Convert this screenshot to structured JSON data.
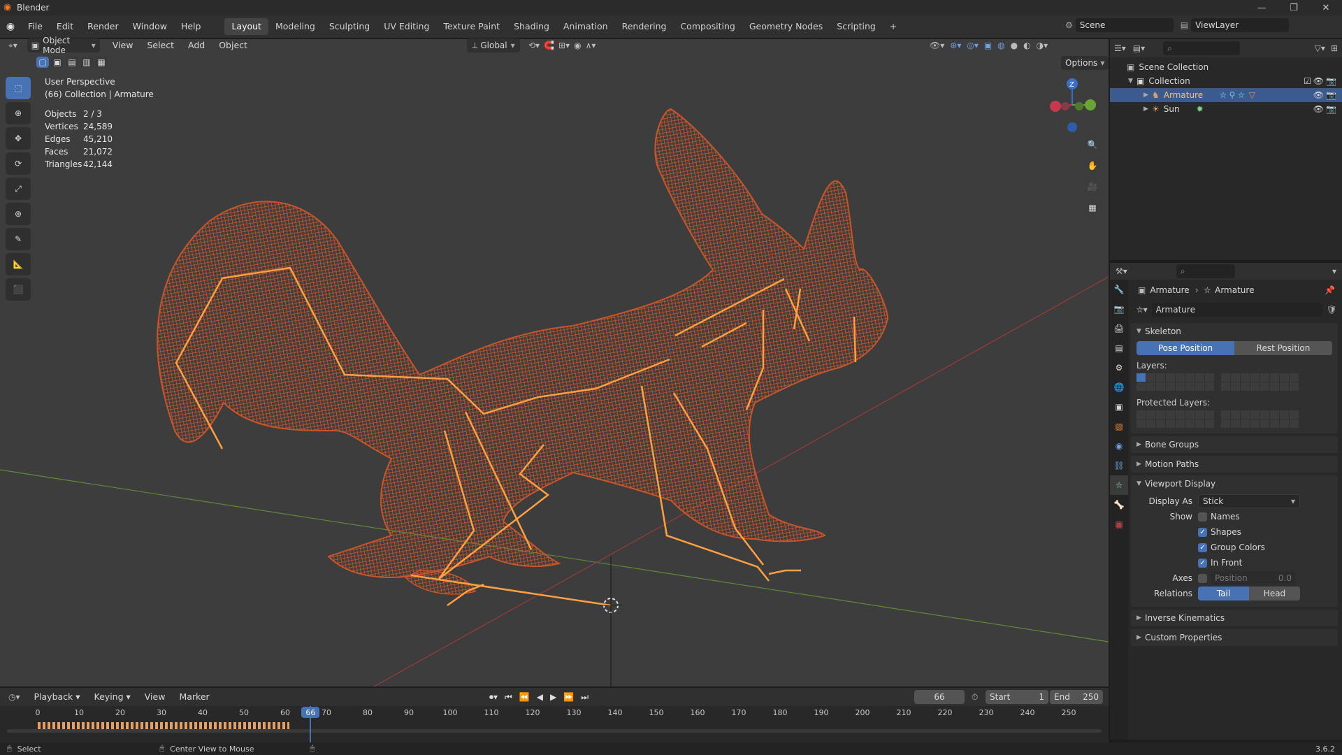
{
  "window": {
    "title": "Blender"
  },
  "menus": [
    "File",
    "Edit",
    "Render",
    "Window",
    "Help"
  ],
  "workspaces": [
    "Layout",
    "Modeling",
    "Sculpting",
    "UV Editing",
    "Texture Paint",
    "Shading",
    "Animation",
    "Rendering",
    "Compositing",
    "Geometry Nodes",
    "Scripting"
  ],
  "active_workspace": "Layout",
  "add_workspace": "+",
  "scene": {
    "name": "Scene",
    "view_layer": "ViewLayer"
  },
  "viewport": {
    "mode": "Object Mode",
    "menus": [
      "View",
      "Select",
      "Add",
      "Object"
    ],
    "transform_orientation": "Global",
    "options_label": "Options",
    "perspective": "User Perspective",
    "collection_line": "(66) Collection | Armature",
    "stats": [
      {
        "k": "Objects",
        "v": "2 / 3"
      },
      {
        "k": "Vertices",
        "v": "24,589"
      },
      {
        "k": "Edges",
        "v": "45,210"
      },
      {
        "k": "Faces",
        "v": "21,072"
      },
      {
        "k": "Triangles",
        "v": "42,144"
      }
    ],
    "gizmo": {
      "z": "Z"
    }
  },
  "outliner": {
    "scene_collection": "Scene Collection",
    "collection": "Collection",
    "items": [
      {
        "name": "Armature",
        "selected": true
      },
      {
        "name": "Sun",
        "selected": false
      }
    ]
  },
  "properties": {
    "breadcrumb_object": "Armature",
    "breadcrumb_data": "Armature",
    "data_name": "Armature",
    "skeleton": {
      "title": "Skeleton",
      "pose_position": "Pose Position",
      "rest_position": "Rest Position",
      "layers_label": "Layers:",
      "protected_layers_label": "Protected Layers:"
    },
    "bone_groups": "Bone Groups",
    "motion_paths": "Motion Paths",
    "viewport_display": {
      "title": "Viewport Display",
      "display_as_label": "Display As",
      "display_as_value": "Stick",
      "show_label": "Show",
      "names": "Names",
      "shapes": "Shapes",
      "group_colors": "Group Colors",
      "in_front": "In Front",
      "axes_label": "Axes",
      "position_label": "Position",
      "position_value": "0.0",
      "relations_label": "Relations",
      "tail": "Tail",
      "head": "Head"
    },
    "inverse_kinematics": "Inverse Kinematics",
    "custom_properties": "Custom Properties"
  },
  "timeline": {
    "menus": [
      "Playback",
      "Keying",
      "View",
      "Marker"
    ],
    "current_frame": "66",
    "start_label": "Start",
    "start": "1",
    "end_label": "End",
    "end": "250",
    "ruler": [
      "0",
      "10",
      "20",
      "30",
      "40",
      "50",
      "60",
      "70",
      "80",
      "90",
      "100",
      "110",
      "120",
      "130",
      "140",
      "150",
      "160",
      "170",
      "180",
      "190",
      "200",
      "210",
      "220",
      "230",
      "240",
      "250"
    ]
  },
  "statusbar": {
    "select": "Select",
    "center_view": "Center View to Mouse",
    "version": "3.6.2"
  },
  "colors": {
    "accent": "#4772b3",
    "wire": "#c8552a",
    "bone": "#ffa040",
    "viewport_bg": "#3d3d3d"
  }
}
